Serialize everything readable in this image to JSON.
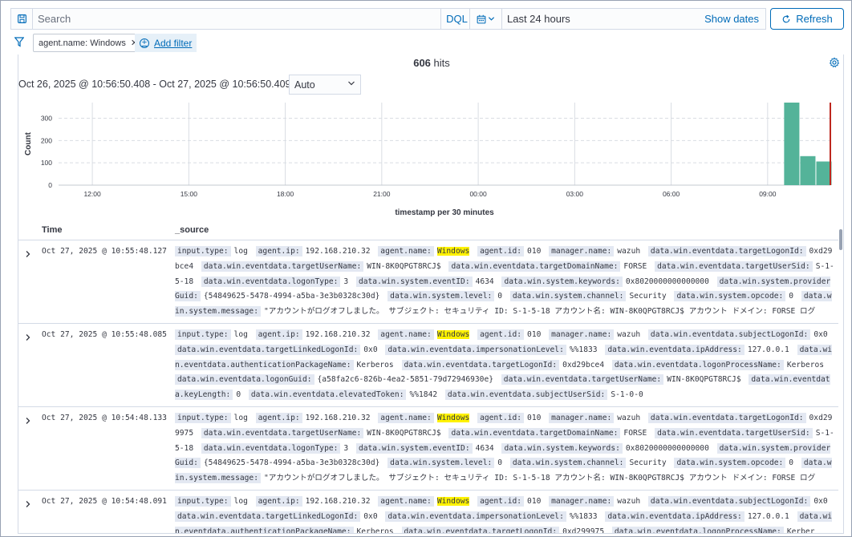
{
  "topbar": {
    "search_placeholder": "Search",
    "dql_label": "DQL",
    "date_range": "Last 24 hours",
    "show_dates_label": "Show dates",
    "refresh_label": "Refresh"
  },
  "filters": {
    "pill_label": "agent.name: Windows",
    "add_filter_label": "Add filter"
  },
  "summary": {
    "hits_count": "606",
    "hits_label": "hits",
    "interval_text": "Oct 26, 2025 @ 10:56:50.408 - Oct 27, 2025 @ 10:56:50.409 per",
    "interval_value": "Auto"
  },
  "colors": {
    "accent": "#006bb8",
    "bar": "#54b399",
    "now_marker": "#bd271e",
    "highlight": "#fff200"
  },
  "chart_data": {
    "type": "bar",
    "xlabel": "timestamp per 30 minutes",
    "ylabel": "Count",
    "ylim": [
      0,
      370
    ],
    "yticks": [
      0,
      100,
      200,
      300
    ],
    "xticks": [
      "12:00",
      "15:00",
      "18:00",
      "21:00",
      "00:00",
      "03:00",
      "06:00",
      "09:00"
    ],
    "xtick_hours": [
      12,
      15,
      18,
      21,
      24,
      27,
      30,
      33
    ],
    "x_range_hours": [
      10.95,
      34.95
    ],
    "bars": [
      {
        "start_hour": 33.5,
        "value": 370
      },
      {
        "start_hour": 34.0,
        "value": 130
      },
      {
        "start_hour": 34.5,
        "value": 106
      }
    ],
    "now_hour": 34.95
  },
  "table": {
    "col_time": "Time",
    "col_source": "_source",
    "rows": [
      {
        "time": "Oct 27, 2025 @ 10:55:48.127",
        "fields": [
          [
            "input.type:",
            "log"
          ],
          [
            "agent.ip:",
            "192.168.210.32"
          ],
          [
            "agent.name:",
            "Windows"
          ],
          [
            "agent.id:",
            "010"
          ],
          [
            "manager.name:",
            "wazuh"
          ],
          [
            "data.win.eventdata.targetLogonId:",
            "0xd29bce4"
          ],
          [
            "data.win.eventdata.targetUserName:",
            "WIN-8K0QPGT8RCJ$"
          ],
          [
            "data.win.eventdata.targetDomainName:",
            "FORSE"
          ],
          [
            "data.win.eventdata.targetUserSid:",
            "S-1-5-18"
          ],
          [
            "data.win.eventdata.logonType:",
            "3"
          ],
          [
            "data.win.system.eventID:",
            "4634"
          ],
          [
            "data.win.system.keywords:",
            "0x8020000000000000"
          ],
          [
            "data.win.system.providerGuid:",
            "{54849625-5478-4994-a5ba-3e3b0328c30d}"
          ],
          [
            "data.win.system.level:",
            "0"
          ],
          [
            "data.win.system.channel:",
            "Security"
          ],
          [
            "data.win.system.opcode:",
            "0"
          ],
          [
            "data.win.system.message:",
            "\"アカウントがログオフしました。 サブジェクト: セキュリティ ID: S-1-5-18 アカウント名: WIN-8K0QPGT8RCJ$ アカウント ドメイン: FORSE ログ"
          ]
        ]
      },
      {
        "time": "Oct 27, 2025 @ 10:55:48.085",
        "fields": [
          [
            "input.type:",
            "log"
          ],
          [
            "agent.ip:",
            "192.168.210.32"
          ],
          [
            "agent.name:",
            "Windows"
          ],
          [
            "agent.id:",
            "010"
          ],
          [
            "manager.name:",
            "wazuh"
          ],
          [
            "data.win.eventdata.subjectLogonId:",
            "0x0"
          ],
          [
            "data.win.eventdata.targetLinkedLogonId:",
            "0x0"
          ],
          [
            "data.win.eventdata.impersonationLevel:",
            "%%1833"
          ],
          [
            "data.win.eventdata.ipAddress:",
            "127.0.0.1"
          ],
          [
            "data.win.eventdata.authenticationPackageName:",
            "Kerberos"
          ],
          [
            "data.win.eventdata.targetLogonId:",
            "0xd29bce4"
          ],
          [
            "data.win.eventdata.logonProcessName:",
            "Kerberos"
          ],
          [
            "data.win.eventdata.logonGuid:",
            "{a58fa2c6-826b-4ea2-5851-79d72946930e}"
          ],
          [
            "data.win.eventdata.targetUserName:",
            "WIN-8K0QPGT8RCJ$"
          ],
          [
            "data.win.eventdata.keyLength:",
            "0"
          ],
          [
            "data.win.eventdata.elevatedToken:",
            "%%1842"
          ],
          [
            "data.win.eventdata.subjectUserSid:",
            "S-1-0-0"
          ]
        ]
      },
      {
        "time": "Oct 27, 2025 @ 10:54:48.133",
        "fields": [
          [
            "input.type:",
            "log"
          ],
          [
            "agent.ip:",
            "192.168.210.32"
          ],
          [
            "agent.name:",
            "Windows"
          ],
          [
            "agent.id:",
            "010"
          ],
          [
            "manager.name:",
            "wazuh"
          ],
          [
            "data.win.eventdata.targetLogonId:",
            "0xd299975"
          ],
          [
            "data.win.eventdata.targetUserName:",
            "WIN-8K0QPGT8RCJ$"
          ],
          [
            "data.win.eventdata.targetDomainName:",
            "FORSE"
          ],
          [
            "data.win.eventdata.targetUserSid:",
            "S-1-5-18"
          ],
          [
            "data.win.eventdata.logonType:",
            "3"
          ],
          [
            "data.win.system.eventID:",
            "4634"
          ],
          [
            "data.win.system.keywords:",
            "0x8020000000000000"
          ],
          [
            "data.win.system.providerGuid:",
            "{54849625-5478-4994-a5ba-3e3b0328c30d}"
          ],
          [
            "data.win.system.level:",
            "0"
          ],
          [
            "data.win.system.channel:",
            "Security"
          ],
          [
            "data.win.system.opcode:",
            "0"
          ],
          [
            "data.win.system.message:",
            "\"アカウントがログオフしました。 サブジェクト: セキュリティ ID: S-1-5-18 アカウント名: WIN-8K0QPGT8RCJ$ アカウント ドメイン: FORSE ログ"
          ]
        ]
      },
      {
        "time": "Oct 27, 2025 @ 10:54:48.091",
        "fields": [
          [
            "input.type:",
            "log"
          ],
          [
            "agent.ip:",
            "192.168.210.32"
          ],
          [
            "agent.name:",
            "Windows"
          ],
          [
            "agent.id:",
            "010"
          ],
          [
            "manager.name:",
            "wazuh"
          ],
          [
            "data.win.eventdata.subjectLogonId:",
            "0x0"
          ],
          [
            "data.win.eventdata.targetLinkedLogonId:",
            "0x0"
          ],
          [
            "data.win.eventdata.impersonationLevel:",
            "%%1833"
          ],
          [
            "data.win.eventdata.ipAddress:",
            "127.0.0.1"
          ],
          [
            "data.win.eventdata.authenticationPackageName:",
            "Kerberos"
          ],
          [
            "data.win.eventdata.targetLogonId:",
            "0xd299975"
          ],
          [
            "data.win.eventdata.logonProcessName:",
            "Kerber"
          ]
        ]
      }
    ]
  }
}
